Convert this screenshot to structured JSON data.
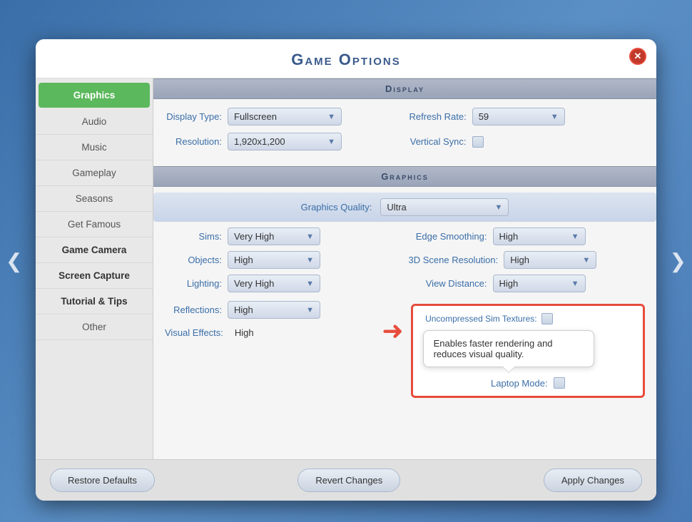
{
  "app": {
    "title": "Game Options"
  },
  "nav": {
    "left_arrow": "❮",
    "right_arrow": "❯"
  },
  "sidebar": {
    "items": [
      {
        "id": "graphics",
        "label": "Graphics",
        "active": true
      },
      {
        "id": "audio",
        "label": "Audio"
      },
      {
        "id": "music",
        "label": "Music"
      },
      {
        "id": "gameplay",
        "label": "Gameplay"
      },
      {
        "id": "seasons",
        "label": "Seasons"
      },
      {
        "id": "get-famous",
        "label": "Get Famous"
      },
      {
        "id": "game-camera",
        "label": "Game Camera",
        "bold": true
      },
      {
        "id": "screen-capture",
        "label": "Screen Capture",
        "bold": true
      },
      {
        "id": "tutorial-tips",
        "label": "Tutorial & Tips",
        "bold": true
      },
      {
        "id": "other",
        "label": "Other"
      }
    ]
  },
  "sections": {
    "display": {
      "header": "Display",
      "display_type_label": "Display Type:",
      "display_type_value": "Fullscreen",
      "refresh_rate_label": "Refresh Rate:",
      "refresh_rate_value": "59",
      "resolution_label": "Resolution:",
      "resolution_value": "1,920x1,200",
      "vertical_sync_label": "Vertical Sync:"
    },
    "graphics": {
      "header": "Graphics",
      "quality_label": "Graphics Quality:",
      "quality_value": "Ultra",
      "sims_label": "Sims:",
      "sims_value": "Very High",
      "edge_smoothing_label": "Edge Smoothing:",
      "edge_smoothing_value": "High",
      "objects_label": "Objects:",
      "objects_value": "High",
      "scene_resolution_label": "3D Scene Resolution:",
      "scene_resolution_value": "High",
      "lighting_label": "Lighting:",
      "lighting_value": "Very High",
      "view_distance_label": "View Distance:",
      "view_distance_value": "High",
      "reflections_label": "Reflections:",
      "reflections_value": "High",
      "uncompressed_label": "Uncompressed Sim Textures:",
      "visual_effects_label": "Visual Effects:",
      "visual_effects_value": "High",
      "laptop_mode_label": "Laptop Mode:",
      "tooltip_text": "Enables faster rendering and reduces visual quality."
    }
  },
  "footer": {
    "restore_defaults": "Restore Defaults",
    "revert_changes": "Revert Changes",
    "apply_changes": "Apply Changes"
  },
  "close_label": "✕"
}
